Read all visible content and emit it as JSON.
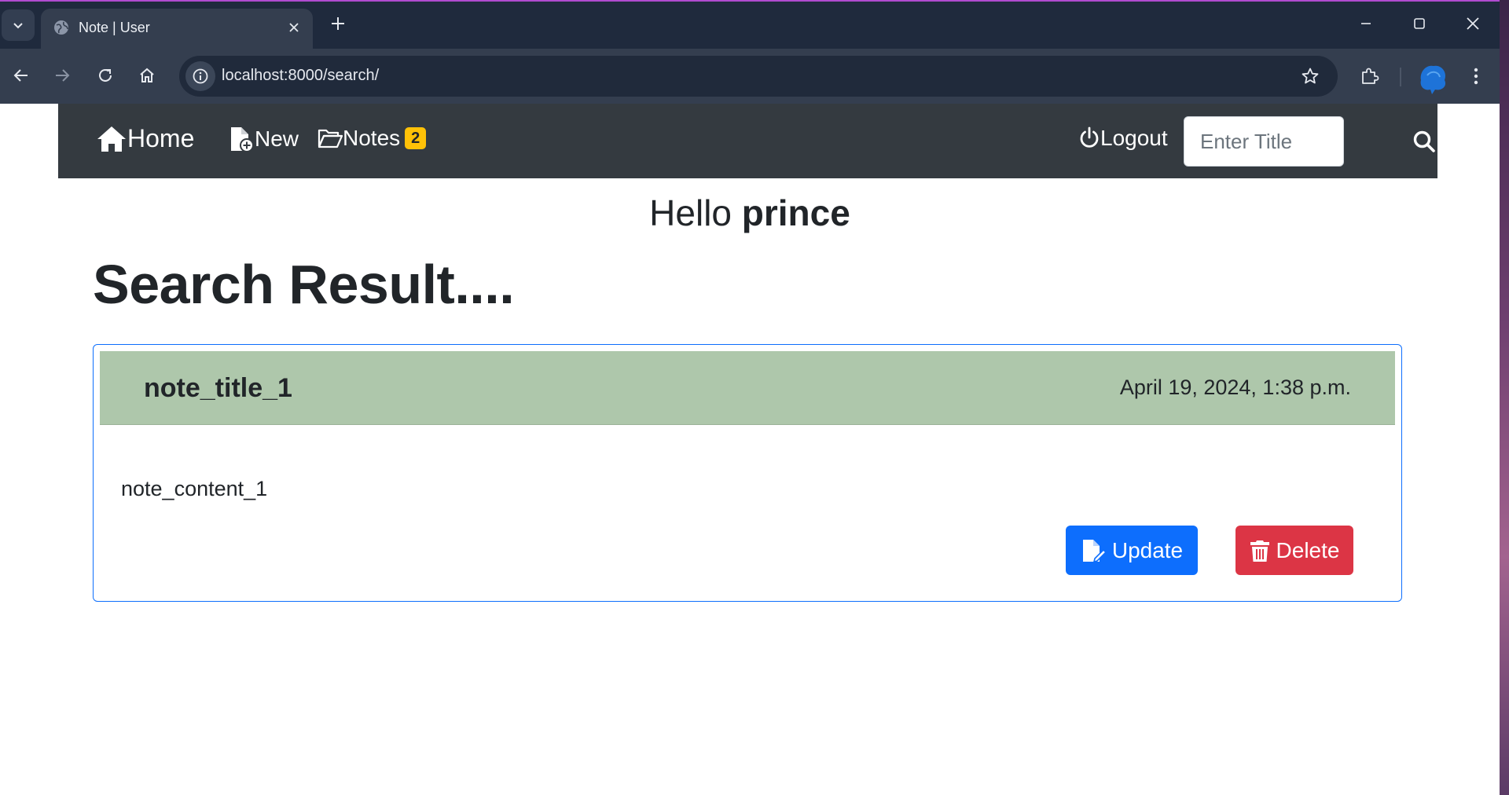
{
  "browser": {
    "tab_title": "Note | User",
    "url": "localhost:8000/search/"
  },
  "nav": {
    "home_label": "Home",
    "new_label": "New",
    "notes_label": "Notes",
    "notes_count": "2",
    "logout_label": "Logout",
    "search_placeholder": "Enter Title"
  },
  "greeting": {
    "prefix": "Hello",
    "username": "prince"
  },
  "heading": "Search Result....",
  "notes": [
    {
      "title": "note_title_1",
      "date": "April 19, 2024, 1:38 p.m.",
      "content": "note_content_1",
      "update_label": "Update",
      "delete_label": "Delete"
    }
  ],
  "colors": {
    "navbar": "#343a40",
    "badge": "#ffc107",
    "card_header": "#aec7ab",
    "update_button": "#0d6efd",
    "delete_button": "#dc3545"
  }
}
